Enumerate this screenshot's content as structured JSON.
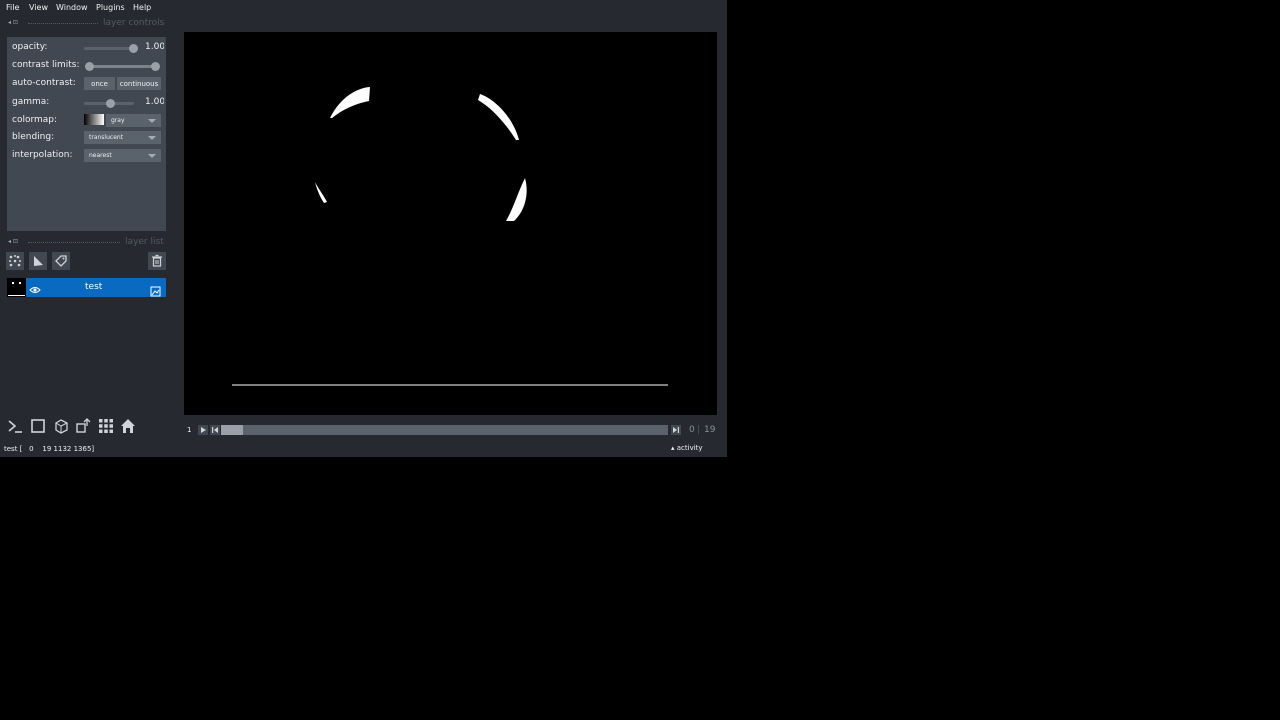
{
  "menu": {
    "items": [
      "File",
      "View",
      "Window",
      "Plugins",
      "Help"
    ]
  },
  "layer_controls": {
    "title": "layer controls",
    "opacity": {
      "label": "opacity:",
      "value": "1.00",
      "level": 1.0
    },
    "contrast_limits": {
      "label": "contrast limits:",
      "low": 0.0,
      "high": 1.0
    },
    "auto_contrast": {
      "label": "auto-contrast:",
      "once": "once",
      "continuous": "continuous"
    },
    "gamma": {
      "label": "gamma:",
      "value": "1.00",
      "level": 0.5
    },
    "colormap": {
      "label": "colormap:",
      "value": "gray"
    },
    "blending": {
      "label": "blending:",
      "value": "translucent"
    },
    "interpolation": {
      "label": "interpolation:",
      "value": "nearest"
    }
  },
  "layer_list": {
    "title": "layer list",
    "layers": [
      {
        "name": "test",
        "visible": true,
        "selected": true
      }
    ]
  },
  "dims": {
    "axis_label": "1",
    "current": "0",
    "max": "19",
    "position_fraction": 0.0
  },
  "status": {
    "text": "test [   0    19 1132 1365]",
    "activity": "activity"
  },
  "colors": {
    "background": "#262930",
    "panel": "#414851",
    "selection": "#0a69c1",
    "canvas": "#000000"
  },
  "icons": [
    "console-icon",
    "2d-3d-toggle-icon",
    "roll-dims-icon",
    "transpose-icon",
    "grid-icon",
    "home-icon",
    "eye-icon",
    "image-layer-icon",
    "points-icon",
    "shapes-icon",
    "labels-icon",
    "delete-icon"
  ]
}
